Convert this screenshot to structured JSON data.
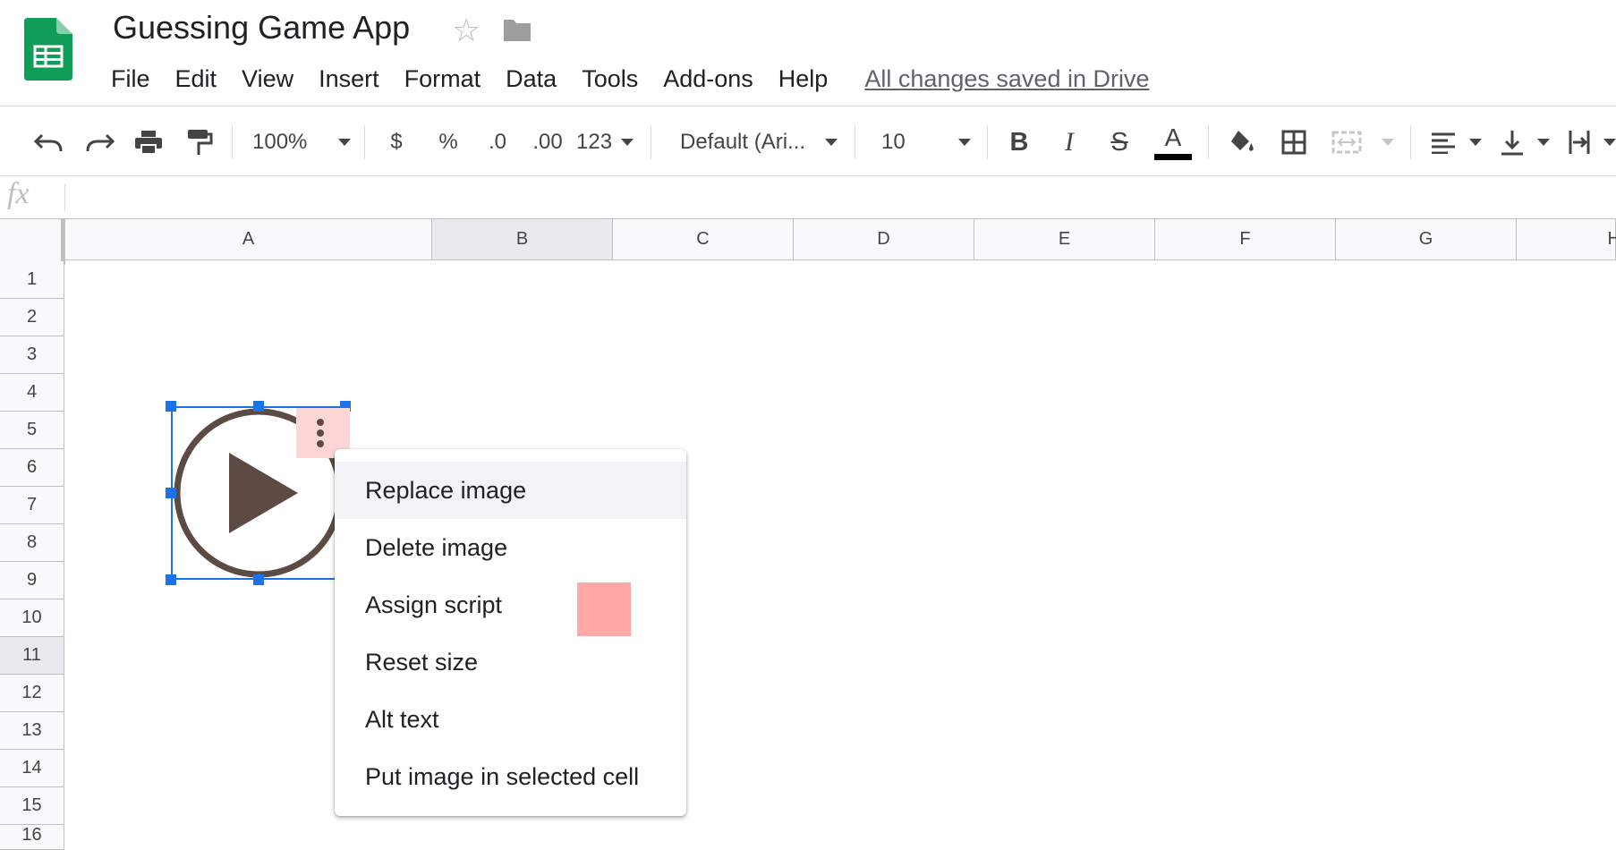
{
  "app": {
    "title": "Guessing Game App",
    "save_status": "All changes saved in Drive",
    "accent_color": "#1a73e8",
    "logo_color": "#0f9d58"
  },
  "menu": [
    "File",
    "Edit",
    "View",
    "Insert",
    "Format",
    "Data",
    "Tools",
    "Add-ons",
    "Help"
  ],
  "toolbar": {
    "zoom": "100%",
    "currency": "$",
    "percent": "%",
    "decrease_decimal": ".0",
    "increase_decimal": ".00",
    "number_format": "123",
    "font": "Default (Ari...",
    "font_size": "10",
    "bold": "B",
    "italic": "I",
    "strikethrough": "S",
    "text_color": "A",
    "icons": [
      "undo-icon",
      "redo-icon",
      "print-icon",
      "paint-format-icon",
      "fill-color-icon",
      "borders-icon",
      "merge-cells-icon",
      "horizontal-align-icon",
      "vertical-align-icon",
      "text-wrap-icon"
    ]
  },
  "formula_bar": {
    "label": "fx",
    "value": ""
  },
  "grid": {
    "columns": [
      "A",
      "B",
      "C",
      "D",
      "E",
      "F",
      "G",
      "H"
    ],
    "rows": [
      "1",
      "2",
      "3",
      "4",
      "5",
      "6",
      "7",
      "8",
      "9",
      "10",
      "11",
      "12",
      "13",
      "14",
      "15",
      "16"
    ],
    "selected_column": "B",
    "selected_row": "11"
  },
  "image": {
    "icon": "play-circle-icon",
    "color": "#5d4a43"
  },
  "context_menu": {
    "items": [
      "Replace image",
      "Delete image",
      "Assign script",
      "Reset size",
      "Alt text",
      "Put image in selected cell"
    ],
    "hovered": "Replace image"
  }
}
